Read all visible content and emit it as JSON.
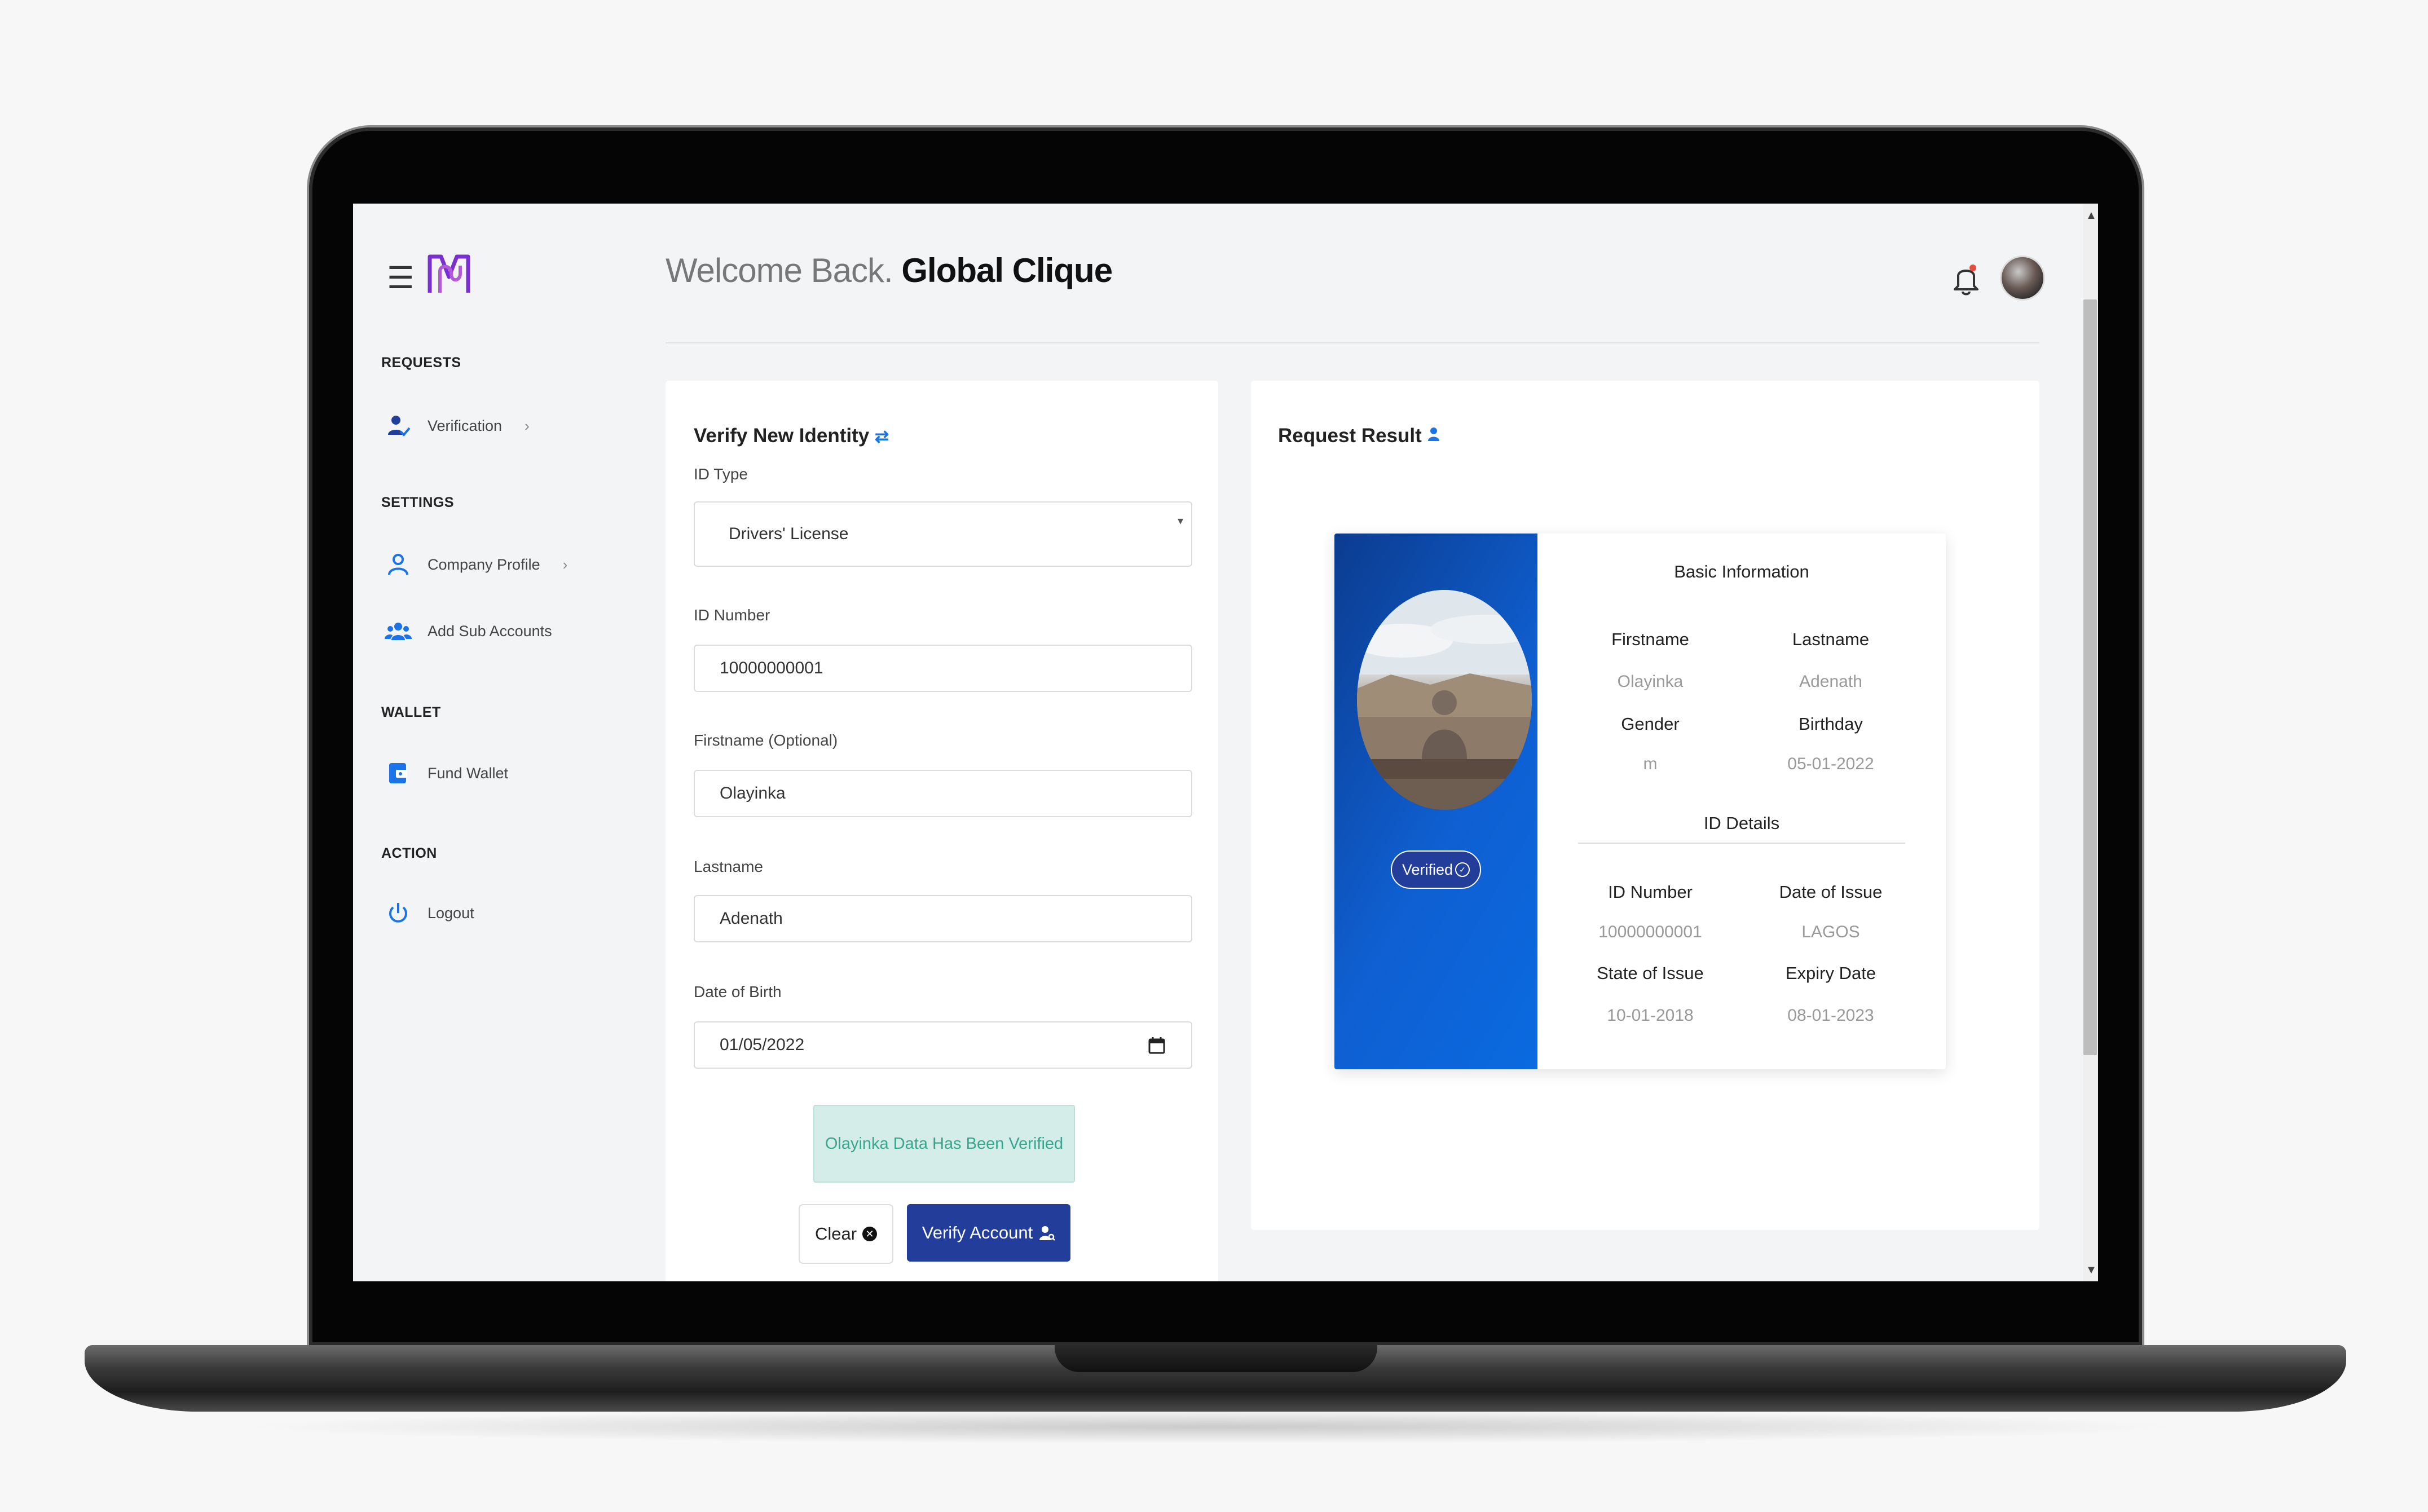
{
  "app": {
    "welcome_prefix": "Welcome Back.",
    "user_name": "Global Clique"
  },
  "sidebar": {
    "sections": [
      {
        "label": "REQUESTS",
        "items": [
          {
            "label": "Verification",
            "icon": "user-check-icon",
            "chevron": true
          }
        ]
      },
      {
        "label": "SETTINGS",
        "items": [
          {
            "label": "Company Profile",
            "icon": "user-icon",
            "chevron": true
          },
          {
            "label": "Add Sub Accounts",
            "icon": "users-icon",
            "chevron": false
          }
        ]
      },
      {
        "label": "WALLET",
        "items": [
          {
            "label": "Fund Wallet",
            "icon": "wallet-icon",
            "chevron": false
          }
        ]
      },
      {
        "label": "ACTION",
        "items": [
          {
            "label": "Logout",
            "icon": "power-icon",
            "chevron": false
          }
        ]
      }
    ]
  },
  "form": {
    "title": "Verify New Identity",
    "id_type_label": "ID Type",
    "id_type_value": "Drivers' License",
    "id_number_label": "ID Number",
    "id_number_value": "10000000001",
    "firstname_label": "Firstname (Optional)",
    "firstname_value": "Olayinka",
    "lastname_label": "Lastname",
    "lastname_value": "Adenath",
    "dob_label": "Date of Birth",
    "dob_value": "01/05/2022",
    "alert_text": "Olayinka Data Has Been Verified",
    "clear_label": "Clear",
    "verify_label": "Verify Account"
  },
  "result": {
    "title": "Request Result",
    "badge": "Verified",
    "basic_heading": "Basic Information",
    "firstname_key": "Firstname",
    "firstname_val": "Olayinka",
    "lastname_key": "Lastname",
    "lastname_val": "Adenath",
    "gender_key": "Gender",
    "gender_val": "m",
    "birthday_key": "Birthday",
    "birthday_val": "05-01-2022",
    "id_heading": "ID Details",
    "idnum_key": "ID Number",
    "idnum_val": "10000000001",
    "doi_key": "Date of Issue",
    "doi_val": "LAGOS",
    "soi_key": "State of Issue",
    "soi_val": "10-01-2018",
    "exp_key": "Expiry Date",
    "exp_val": "08-01-2023"
  },
  "colors": {
    "primary": "#233d9a",
    "accent_blue": "#0f5fd1",
    "logo_purple": "#7a2fd0",
    "success_text": "#38a58e",
    "success_bg": "#d4ede9"
  }
}
